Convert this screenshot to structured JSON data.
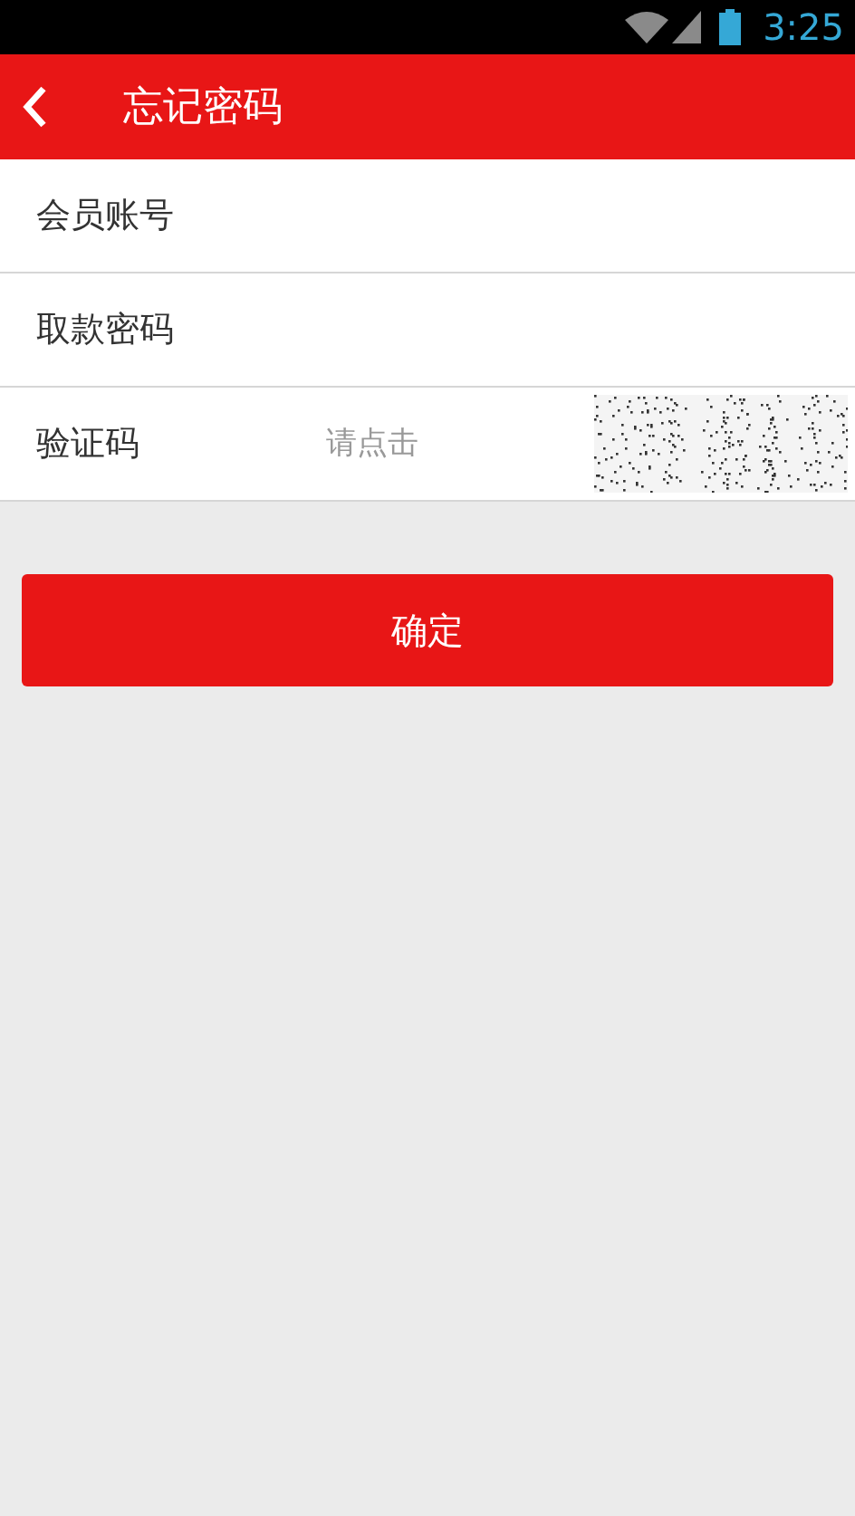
{
  "status_bar": {
    "time": "3:25"
  },
  "header": {
    "title": "忘记密码"
  },
  "fields": [
    {
      "kind": "text",
      "label": "会员账号"
    },
    {
      "kind": "text",
      "label": "取款密码"
    },
    {
      "kind": "captcha",
      "label": "验证码",
      "placeholder": "请点击"
    }
  ],
  "submit": "确定"
}
